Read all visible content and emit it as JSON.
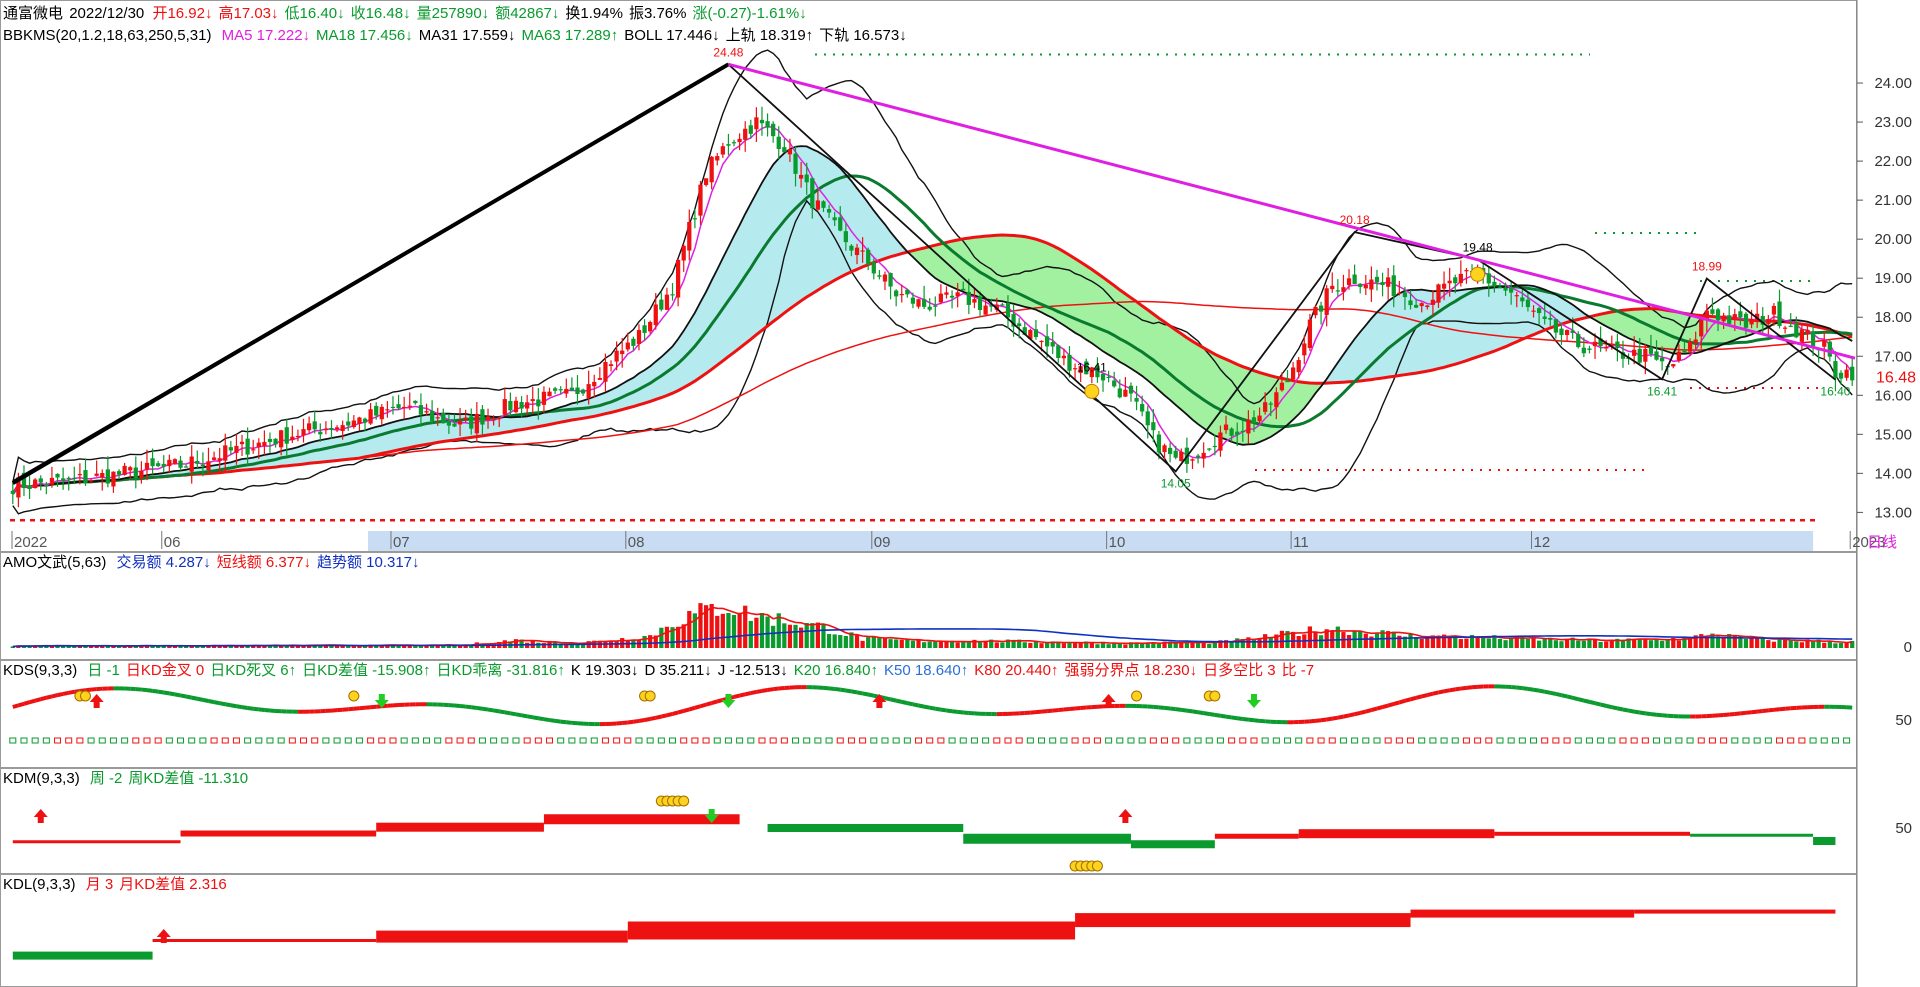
{
  "header": {
    "stock_name": "通富微电",
    "date": "2022/12/30",
    "quote": [
      {
        "text": "开16.92↓",
        "color": "red"
      },
      {
        "text": "高17.03↓",
        "color": "red"
      },
      {
        "text": "低16.40↓",
        "color": "green"
      },
      {
        "text": "收16.48↓",
        "color": "green"
      },
      {
        "text": "量257890↓",
        "color": "green"
      },
      {
        "text": "额42867↓",
        "color": "green"
      },
      {
        "text": "换1.94%",
        "color": "black"
      },
      {
        "text": "振3.76%",
        "color": "black"
      },
      {
        "text": "涨(-0.27)-1.61%↓",
        "color": "green"
      }
    ]
  },
  "main_panel": {
    "indicator": "BBKMS(20,1.2,18,63,250,5,31)",
    "legend": [
      {
        "text": "MA5 17.222↓",
        "color": "mag"
      },
      {
        "text": "MA18 17.456↓",
        "color": "green"
      },
      {
        "text": "MA31 17.559↓",
        "color": "black"
      },
      {
        "text": "MA63 17.289↑",
        "color": "green"
      },
      {
        "text": "BOLL 17.446↓",
        "color": "black"
      },
      {
        "text": "上轨 18.319↑",
        "color": "black"
      },
      {
        "text": "下轨 16.573↓",
        "color": "black"
      }
    ],
    "price_tag": "16.48",
    "period": "日线"
  },
  "chart_data": [
    {
      "type": "candlestick",
      "ylim": [
        12.6,
        25.0
      ],
      "yticks": [
        "24.00",
        "23.00",
        "22.00",
        "21.00",
        "20.00",
        "19.00",
        "18.00",
        "17.00",
        "16.00",
        "15.00",
        "14.00",
        "13.00"
      ],
      "yvalues": [
        24,
        23,
        22,
        21,
        20,
        19,
        18,
        17,
        16,
        15,
        14,
        13
      ],
      "xaxis_labels": [
        {
          "t": "2022",
          "i": 2
        },
        {
          "t": "06",
          "i": 27
        },
        {
          "t": "07",
          "i": 68
        },
        {
          "t": "08",
          "i": 110
        },
        {
          "t": "09",
          "i": 154
        },
        {
          "t": "10",
          "i": 196
        },
        {
          "t": "11",
          "i": 229
        },
        {
          "t": "12",
          "i": 272
        },
        {
          "t": "2023",
          "i": 329
        }
      ],
      "annotations": [
        {
          "t": "24.48",
          "i": 128,
          "v": 24.48,
          "color": "red"
        },
        {
          "t": "20.18",
          "i": 240,
          "v": 20.18,
          "color": "red"
        },
        {
          "t": "19.48",
          "i": 262,
          "v": 19.48,
          "color": "black"
        },
        {
          "t": "18.99",
          "i": 303,
          "v": 18.99,
          "color": "red"
        },
        {
          "t": "16.41",
          "i": 193,
          "v": 16.41,
          "color": "black"
        },
        {
          "t": "14.05",
          "i": 208,
          "v": 14.05,
          "color": "green"
        },
        {
          "t": "16.41",
          "i": 295,
          "v": 16.41,
          "color": "green"
        },
        {
          "t": "16.40",
          "i": 326,
          "v": 16.4,
          "color": "green"
        }
      ],
      "anchors": [
        [
          0,
          13.7
        ],
        [
          10,
          13.8
        ],
        [
          20,
          14.0
        ],
        [
          30,
          14.2
        ],
        [
          40,
          14.6
        ],
        [
          50,
          15.0
        ],
        [
          60,
          15.3
        ],
        [
          70,
          15.7
        ],
        [
          80,
          15.2
        ],
        [
          90,
          15.8
        ],
        [
          100,
          16.0
        ],
        [
          106,
          16.8
        ],
        [
          112,
          17.5
        ],
        [
          118,
          18.8
        ],
        [
          124,
          21.7
        ],
        [
          128,
          22.5
        ],
        [
          133,
          23.0
        ],
        [
          138,
          22.4
        ],
        [
          143,
          21.0
        ],
        [
          148,
          20.1
        ],
        [
          153,
          19.4
        ],
        [
          158,
          18.6
        ],
        [
          163,
          18.3
        ],
        [
          170,
          18.5
        ],
        [
          176,
          18.2
        ],
        [
          182,
          17.6
        ],
        [
          188,
          16.9
        ],
        [
          195,
          16.5
        ],
        [
          200,
          15.9
        ],
        [
          204,
          14.9
        ],
        [
          208,
          14.3
        ],
        [
          212,
          14.6
        ],
        [
          216,
          15.0
        ],
        [
          220,
          15.2
        ],
        [
          224,
          15.6
        ],
        [
          228,
          16.4
        ],
        [
          232,
          17.8
        ],
        [
          236,
          18.8
        ],
        [
          240,
          19.0
        ],
        [
          246,
          18.8
        ],
        [
          252,
          18.4
        ],
        [
          258,
          18.9
        ],
        [
          262,
          19.1
        ],
        [
          268,
          18.6
        ],
        [
          274,
          17.8
        ],
        [
          280,
          17.3
        ],
        [
          286,
          17.1
        ],
        [
          292,
          17.0
        ],
        [
          296,
          16.7
        ],
        [
          300,
          17.2
        ],
        [
          303,
          18.2
        ],
        [
          306,
          18.0
        ],
        [
          310,
          17.8
        ],
        [
          315,
          18.1
        ],
        [
          320,
          17.6
        ],
        [
          324,
          17.2
        ],
        [
          326,
          16.6
        ]
      ]
    },
    {
      "type": "bar",
      "title": "AMO文武(5,63)",
      "legend": [
        {
          "text": "交易额 4.287↓",
          "color": "blue"
        },
        {
          "text": "短线额 6.377↓",
          "color": "red"
        },
        {
          "text": "趋势额 10.317↓",
          "color": "blue"
        }
      ],
      "ylim": [
        0,
        12
      ],
      "ytick": "0",
      "volume_anchors": [
        [
          0,
          0.35
        ],
        [
          80,
          0.45
        ],
        [
          85,
          0.9
        ],
        [
          90,
          1.3
        ],
        [
          95,
          1.0
        ],
        [
          100,
          0.9
        ],
        [
          105,
          1.1
        ],
        [
          110,
          1.6
        ],
        [
          114,
          2.0
        ],
        [
          118,
          4.2
        ],
        [
          122,
          5.6
        ],
        [
          125,
          6.4
        ],
        [
          128,
          7.0
        ],
        [
          132,
          5.4
        ],
        [
          138,
          4.6
        ],
        [
          146,
          3.2
        ],
        [
          152,
          1.5
        ],
        [
          160,
          1.2
        ],
        [
          170,
          1.2
        ],
        [
          185,
          1.0
        ],
        [
          200,
          0.8
        ],
        [
          215,
          0.9
        ],
        [
          222,
          1.5
        ],
        [
          230,
          2.6
        ],
        [
          236,
          3.2
        ],
        [
          242,
          2.7
        ],
        [
          250,
          2.0
        ],
        [
          260,
          1.8
        ],
        [
          270,
          1.5
        ],
        [
          285,
          1.2
        ],
        [
          300,
          1.6
        ],
        [
          304,
          2.3
        ],
        [
          310,
          1.5
        ],
        [
          320,
          1.2
        ],
        [
          327,
          1.0
        ]
      ]
    },
    {
      "type": "area",
      "title": "KDS(9,3,3)",
      "legend": [
        {
          "text": "日 -1",
          "color": "green"
        },
        {
          "text": "日KD金叉 0",
          "color": "red"
        },
        {
          "text": "日KD死叉 6↑",
          "color": "green"
        },
        {
          "text": "日KD差值 -15.908↑",
          "color": "green"
        },
        {
          "text": "日KD乖离 -31.816↑",
          "color": "green"
        },
        {
          "text": "K 19.303↓",
          "color": "black"
        },
        {
          "text": "D 35.211↓",
          "color": "black"
        },
        {
          "text": "J -12.513↓",
          "color": "black"
        },
        {
          "text": "K20 16.840↑",
          "color": "green"
        },
        {
          "text": "K50 18.640↑",
          "color": "lblue"
        },
        {
          "text": "K80 20.440↑",
          "color": "red"
        },
        {
          "text": "强弱分界点 18.230↓",
          "color": "red"
        },
        {
          "text": "日多空比 3",
          "color": "red"
        },
        {
          "text": "比 -7",
          "color": "red"
        }
      ],
      "ytick": "50"
    },
    {
      "type": "area",
      "title": "KDM(9,3,3)",
      "legend": [
        {
          "text": "周 -2",
          "color": "green"
        },
        {
          "text": "周KD差值 -11.310",
          "color": "green"
        }
      ],
      "ytick": "50"
    },
    {
      "type": "area",
      "title": "KDL(9,3,3)",
      "legend": [
        {
          "text": "月 3",
          "color": "red"
        },
        {
          "text": "月KD差值 2.316",
          "color": "red"
        }
      ]
    }
  ],
  "colors": {
    "up": "#ee1111",
    "down": "#0a9a2e",
    "ma5": "#e020e0",
    "trend": "#e020e0",
    "grid": "#b8b8b8",
    "cyan_fill": "#a8e6ec",
    "green_fill": "#90ee90",
    "month_band": "#c8dcf4"
  }
}
